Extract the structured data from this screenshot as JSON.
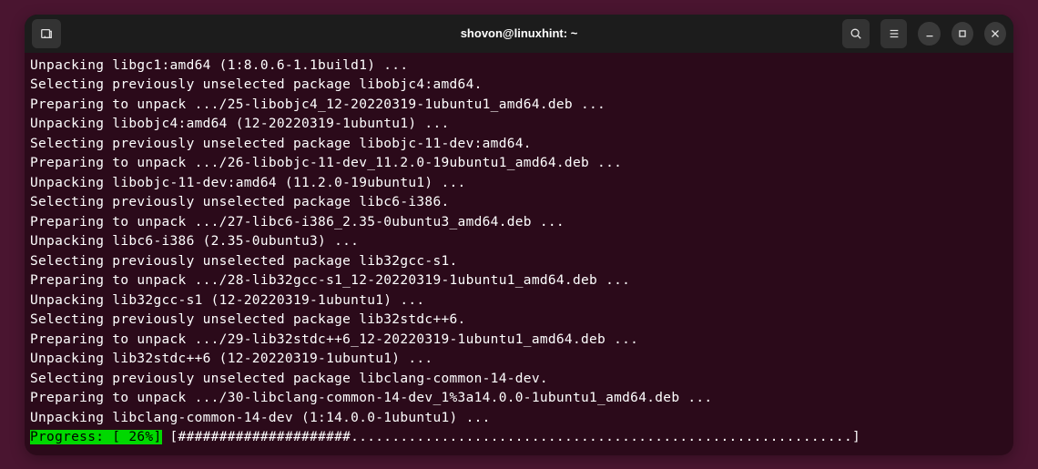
{
  "titlebar": {
    "title": "shovon@linuxhint: ~"
  },
  "terminal": {
    "lines": [
      "Unpacking libgc1:amd64 (1:8.0.6-1.1build1) ...",
      "Selecting previously unselected package libobjc4:amd64.",
      "Preparing to unpack .../25-libobjc4_12-20220319-1ubuntu1_amd64.deb ...",
      "Unpacking libobjc4:amd64 (12-20220319-1ubuntu1) ...",
      "Selecting previously unselected package libobjc-11-dev:amd64.",
      "Preparing to unpack .../26-libobjc-11-dev_11.2.0-19ubuntu1_amd64.deb ...",
      "Unpacking libobjc-11-dev:amd64 (11.2.0-19ubuntu1) ...",
      "Selecting previously unselected package libc6-i386.",
      "Preparing to unpack .../27-libc6-i386_2.35-0ubuntu3_amd64.deb ...",
      "Unpacking libc6-i386 (2.35-0ubuntu3) ...",
      "Selecting previously unselected package lib32gcc-s1.",
      "Preparing to unpack .../28-lib32gcc-s1_12-20220319-1ubuntu1_amd64.deb ...",
      "Unpacking lib32gcc-s1 (12-20220319-1ubuntu1) ...",
      "Selecting previously unselected package lib32stdc++6.",
      "Preparing to unpack .../29-lib32stdc++6_12-20220319-1ubuntu1_amd64.deb ...",
      "Unpacking lib32stdc++6 (12-20220319-1ubuntu1) ...",
      "Selecting previously unselected package libclang-common-14-dev.",
      "Preparing to unpack .../30-libclang-common-14-dev_1%3a14.0.0-1ubuntu1_amd64.deb ...",
      "Unpacking libclang-common-14-dev (1:14.0.0-1ubuntu1) ..."
    ],
    "progress": {
      "label": "Progress:",
      "percent_text": " [ 26%]",
      "bar": " [#####################.............................................................] "
    }
  }
}
